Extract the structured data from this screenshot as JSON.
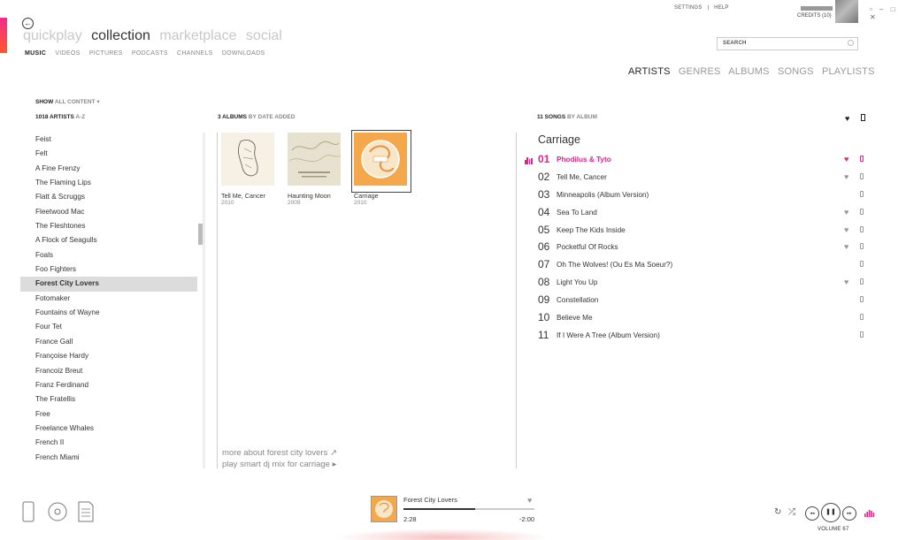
{
  "header": {
    "settings": "SETTINGS",
    "separator": "|",
    "help": "HELP",
    "credits": "CREDITS (10)",
    "window_controls": "▫ – □ ✕",
    "back_glyph": "←"
  },
  "pivots": [
    {
      "label": "quickplay",
      "active": false
    },
    {
      "label": "collection",
      "active": true
    },
    {
      "label": "marketplace",
      "active": false
    },
    {
      "label": "social",
      "active": false
    }
  ],
  "sub_nav": [
    {
      "label": "MUSIC",
      "active": true
    },
    {
      "label": "VIDEOS",
      "active": false
    },
    {
      "label": "PICTURES",
      "active": false
    },
    {
      "label": "PODCASTS",
      "active": false
    },
    {
      "label": "CHANNELS",
      "active": false
    },
    {
      "label": "DOWNLOADS",
      "active": false
    }
  ],
  "search": {
    "placeholder": "SEARCH"
  },
  "view_tabs": [
    {
      "label": "ARTISTS",
      "active": true
    },
    {
      "label": "GENRES",
      "active": false
    },
    {
      "label": "ALBUMS",
      "active": false
    },
    {
      "label": "SONGS",
      "active": false
    },
    {
      "label": "PLAYLISTS",
      "active": false
    }
  ],
  "show_content": {
    "label": "SHOW",
    "value": "ALL CONTENT ▾"
  },
  "artists_header": {
    "count": "1018 ARTISTS",
    "sort": "A-Z"
  },
  "albums_header": {
    "count": "3 ALBUMS",
    "sort": "BY DATE ADDED"
  },
  "songs_header": {
    "count": "11 SONGS",
    "sort": "BY ALBUM"
  },
  "artists": [
    "Feist",
    "Felt",
    "A Fine Frenzy",
    "The Flaming Lips",
    "Flatt & Scruggs",
    "Fleetwood Mac",
    "The Fleshtones",
    "A Flock of Seagulls",
    "Foals",
    "Foo Fighters",
    "Forest City Lovers",
    "Fotomaker",
    "Fountains of Wayne",
    "Four Tet",
    "France Gall",
    "Françoise Hardy",
    "Francoiz Breut",
    "Franz Ferdinand",
    "The Fratellis",
    "Free",
    "Freelance Whales",
    "French II",
    "French Miami"
  ],
  "selected_artist": "Forest City Lovers",
  "albums": [
    {
      "title": "Tell Me, Cancer",
      "year": "2010"
    },
    {
      "title": "Haunting Moon",
      "year": "2009"
    },
    {
      "title": "Carriage",
      "year": "2010"
    }
  ],
  "more_links": {
    "more_about": "more about forest city lovers ↗",
    "smart_dj": "play smart dj mix for carriage ▸"
  },
  "album_title": "Carriage",
  "songs": [
    {
      "num": "01",
      "title": "Phodilus & Tyto",
      "liked": true,
      "playing": true
    },
    {
      "num": "02",
      "title": "Tell Me, Cancer",
      "liked": true,
      "playing": false
    },
    {
      "num": "03",
      "title": "Minneapolis (Album Version)",
      "liked": false,
      "playing": false
    },
    {
      "num": "04",
      "title": "Sea To Land",
      "liked": true,
      "playing": false
    },
    {
      "num": "05",
      "title": "Keep The Kids Inside",
      "liked": true,
      "playing": false
    },
    {
      "num": "06",
      "title": "Pocketful Of Rocks",
      "liked": true,
      "playing": false
    },
    {
      "num": "07",
      "title": "Oh The Wolves! (Ou Es Ma Soeur?)",
      "liked": false,
      "playing": false
    },
    {
      "num": "08",
      "title": "Light You Up",
      "liked": true,
      "playing": false
    },
    {
      "num": "09",
      "title": "Constellation",
      "liked": false,
      "playing": false
    },
    {
      "num": "10",
      "title": "Believe Me",
      "liked": false,
      "playing": false
    },
    {
      "num": "11",
      "title": "If I Were A Tree (Album Version)",
      "liked": false,
      "playing": false
    }
  ],
  "player": {
    "artist": "Forest City Lovers",
    "elapsed": "2:28",
    "remaining": "-2:00",
    "progress_fraction": 0.55,
    "volume": "VOLUME 67"
  },
  "colors": {
    "accent": "#e0248c",
    "accent2": "#ff5a2a"
  },
  "icons": {
    "heart": "♥",
    "prev": "◂◂",
    "pause": "❚❚",
    "next": "▸▸",
    "repeat": "↻",
    "shuffle": "⤮"
  }
}
